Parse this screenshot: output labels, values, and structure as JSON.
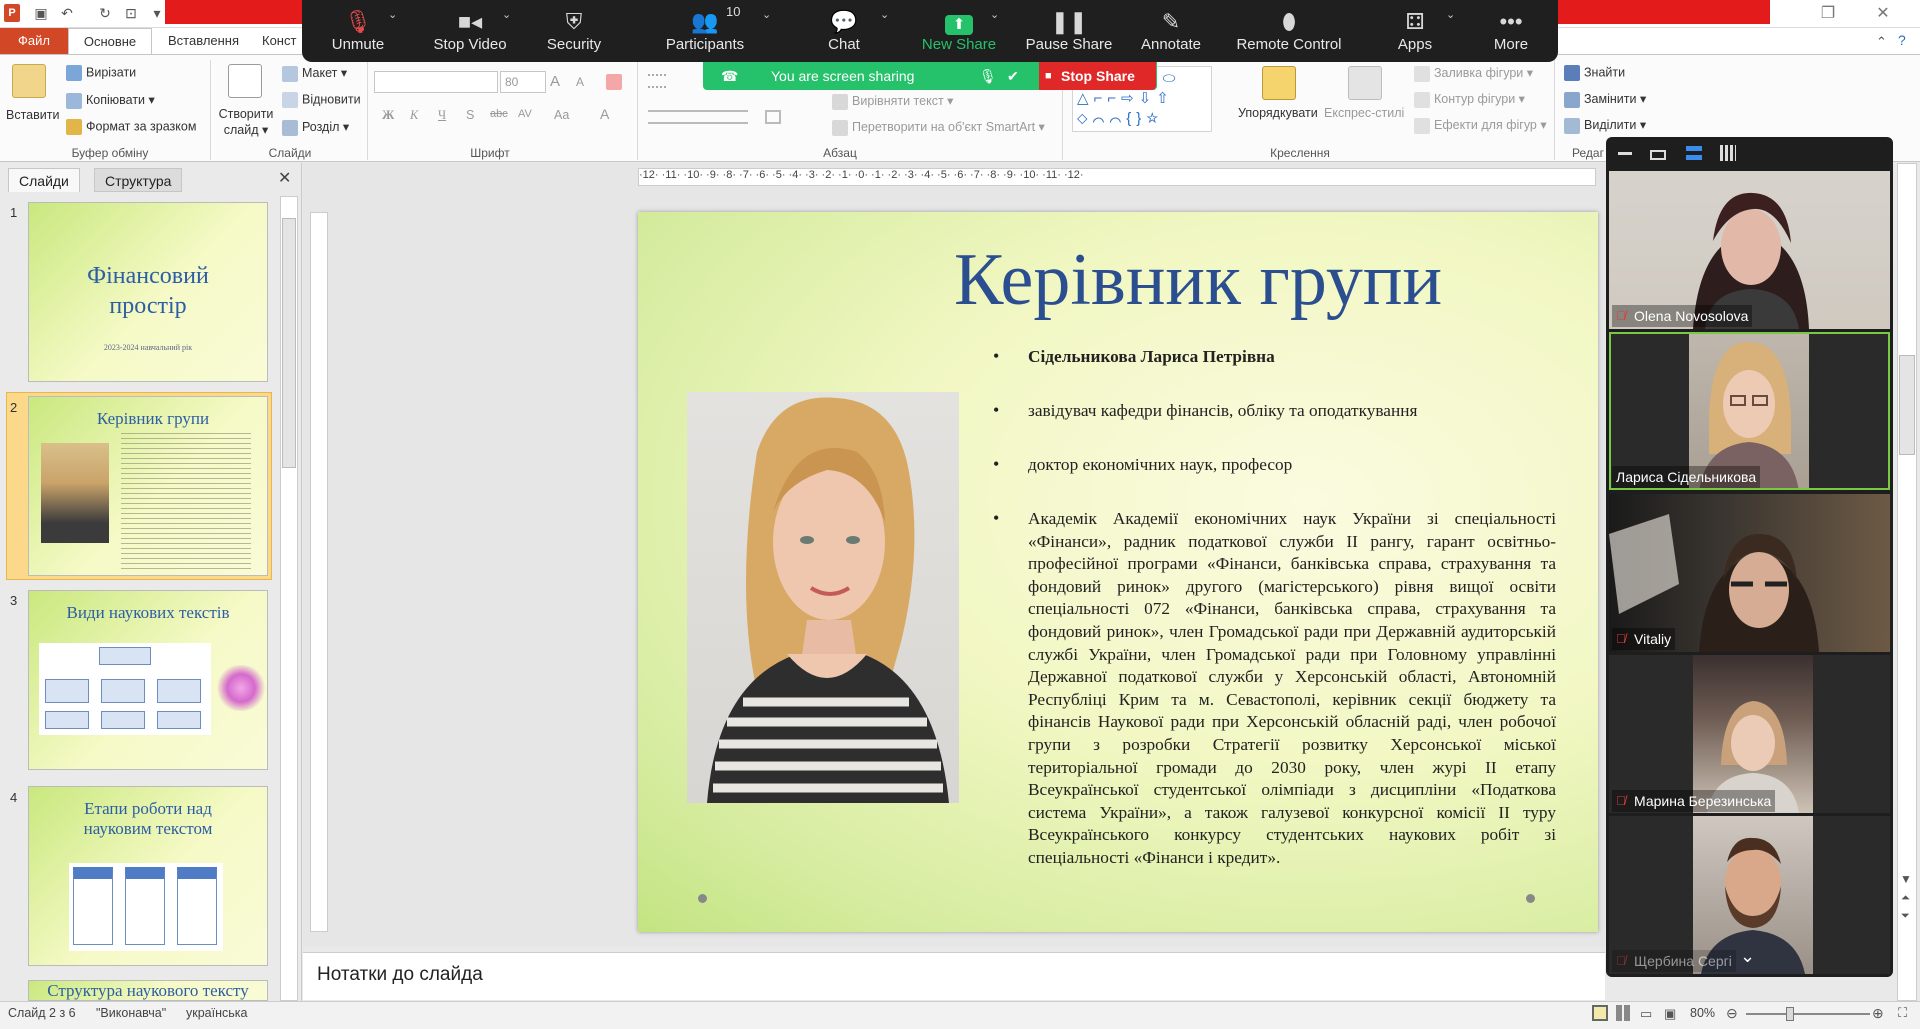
{
  "ribbon": {
    "tabs": [
      "Файл",
      "Основне",
      "Вставлення",
      "Конст"
    ],
    "clipboard": {
      "paste": "Вставити",
      "cut": "Вирізати",
      "copy": "Копіювати",
      "format_painter": "Формат за зразком",
      "group": "Буфер обміну"
    },
    "slides": {
      "new_slide_line1": "Створити",
      "new_slide_line2": "слайд",
      "layout": "Макет",
      "reset": "Відновити",
      "section": "Розділ",
      "group": "Слайди"
    },
    "font": {
      "size": "80",
      "group": "Шрифт",
      "bold": "Ж",
      "italic": "К",
      "underline": "Ч",
      "strike": "S",
      "strike2": "abc",
      "spacing": "AV",
      "case": "Aa",
      "grow": "A",
      "shrink": "A"
    },
    "paragraph": {
      "align_text": "Вирівняти текст",
      "smartart": "Перетворити на об'єкт SmartArt",
      "group": "Абзац"
    },
    "drawing": {
      "arrange": "Упорядкувати",
      "quick_styles": "Експрес-стилі",
      "shape_fill": "Заливка фігури",
      "shape_outline": "Контур фігури",
      "shape_effects": "Ефекти для фігур",
      "group": "Креслення"
    },
    "editing": {
      "find": "Знайти",
      "replace": "Замінити",
      "select": "Виділити",
      "group": "Редаг"
    }
  },
  "zoom": {
    "toolbar": [
      {
        "label": "Unmute",
        "icon": "mic-muted-icon"
      },
      {
        "label": "Stop Video",
        "icon": "video-camera-icon"
      },
      {
        "label": "Security",
        "icon": "shield-icon"
      },
      {
        "label": "Participants",
        "icon": "participants-icon",
        "count": "10"
      },
      {
        "label": "Chat",
        "icon": "chat-icon"
      },
      {
        "label": "New Share",
        "icon": "share-arrow-icon"
      },
      {
        "label": "Pause Share",
        "icon": "pause-icon"
      },
      {
        "label": "Annotate",
        "icon": "pencil-icon"
      },
      {
        "label": "Remote Control",
        "icon": "mouse-icon"
      },
      {
        "label": "Apps",
        "icon": "apps-icon"
      },
      {
        "label": "More",
        "icon": "more-dots-icon"
      }
    ],
    "sharing_text": "You are screen sharing",
    "stop_share": "Stop Share",
    "participants": [
      {
        "name": "Olena Novosolova",
        "muted": true
      },
      {
        "name": "Лариса Сідельникова",
        "muted": false
      },
      {
        "name": "Vitaliy",
        "muted": true
      },
      {
        "name": "Марина Березинська",
        "muted": true
      },
      {
        "name": "Щербина Сергі",
        "muted": true
      }
    ]
  },
  "panel": {
    "tab_slides": "Слайди",
    "tab_outline": "Структура"
  },
  "thumbnails": [
    {
      "num": "1",
      "title": "Фінансовий простір",
      "subtitle": "2023-2024 навчальний рік"
    },
    {
      "num": "2",
      "title": "Керівник групи"
    },
    {
      "num": "3",
      "title": "Види наукових текстів"
    },
    {
      "num": "4",
      "title": "Етапи роботи  над науковим текстом"
    },
    {
      "num": "5",
      "title": "Структура наукового тексту"
    }
  ],
  "slide": {
    "title": "Керівник групи",
    "bullets": [
      "Сідельникова Лариса Петрівна",
      "завідувач кафедри фінансів, обліку та оподаткування",
      "доктор економічних наук, професор",
      "Академік Академії економічних наук України зі спеціальності «Фінанси», радник податкової служби ІІ рангу, гарант освітньо-професійної програми «Фінанси, банківська справа, страхування та фондовий ринок» другого (магістерського) рівня вищої освіти спеціальності 072 «Фінанси, банківська справа, страхування та фондовий ринок», член Громадської ради при Державній аудиторській службі України, член Громадської ради при Головному управлінні Державної податкової служби у Херсонській області, Автономній Республіці Крим та м. Севастополі, керівник секції бюджету та фінансів Наукової ради при Херсонській обласній раді, член робочої групи з розробки Стратегії розвитку Херсонської міської територіальної громади до 2030 року, член журі ІІ етапу Всеукраїнської студентської олімпіади з дисципліни «Податкова система України», а також галузевої конкурсної комісії ІІ туру Всеукраїнського конкурсу студентських наукових робіт зі спеціальності  «Фінанси і кредит»."
    ]
  },
  "notes_placeholder": "Нотатки до слайда",
  "ruler": "·12· ·11· ·10· ·9· ·8· ·7· ·6· ·5· ·4· ·3· ·2· ·1· ·0· ·1· ·2· ·3· ·4· ·5· ·6· ·7· ·8· ·9· ·10· ·11· ·12·",
  "status": {
    "slide": "Слайд 2 з 6",
    "theme": "\"Виконавча\"",
    "language": "українська",
    "zoom": "80%"
  }
}
